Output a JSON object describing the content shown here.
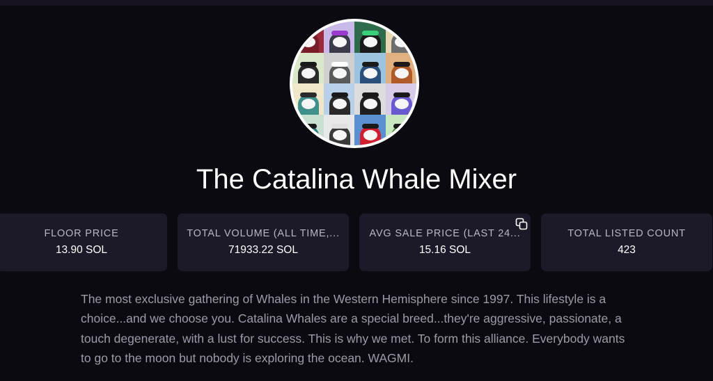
{
  "collection": {
    "title": "The Catalina Whale Mixer",
    "description": "The most exclusive gathering of Whales in the Western Hemisphere since 1997. This lifestyle is a choice...and we choose you. Catalina Whales are a special breed...they're aggressive, passionate, a touch degenerate, with a lust for success. This is why we met. To form this alliance. Everybody wants to go to the moon but nobody is exploring the ocean. WAGMI."
  },
  "stats": [
    {
      "label": "FLOOR PRICE",
      "value": "13.90 SOL"
    },
    {
      "label": "TOTAL VOLUME (ALL TIME,...",
      "value": "71933.22 SOL"
    },
    {
      "label": "AVG SALE PRICE (LAST 24...",
      "value": "15.16 SOL"
    },
    {
      "label": "TOTAL LISTED COUNT",
      "value": "423"
    }
  ],
  "icons": {
    "copy": "copy-icon",
    "avatar": "collection-avatar"
  },
  "colors": {
    "background": "#0b0a10",
    "card": "#1c1a28",
    "text_primary": "#ffffff",
    "text_muted": "#9d9aa9"
  }
}
